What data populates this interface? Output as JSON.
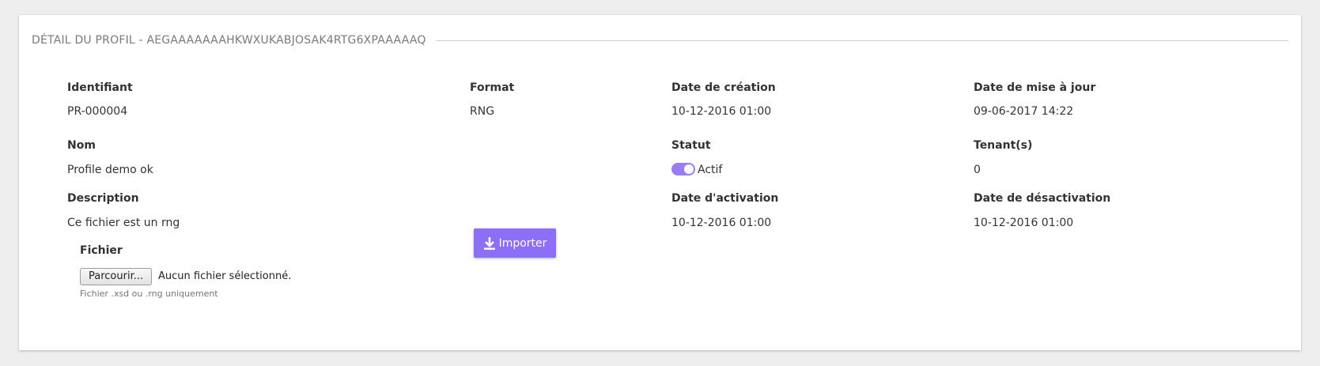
{
  "panel": {
    "title": "DÉTAIL DU PROFIL - AEGAAAAAAAHKWXUKABJOSAK4RTG6XPAAAAAQ"
  },
  "fields": {
    "identifiant": {
      "label": "Identifiant",
      "value": "PR-000004"
    },
    "format": {
      "label": "Format",
      "value": "RNG"
    },
    "date_creation": {
      "label": "Date de création",
      "value": "10-12-2016 01:00"
    },
    "date_maj": {
      "label": "Date de mise à jour",
      "value": "09-06-2017 14:22"
    },
    "nom": {
      "label": "Nom",
      "value": "Profile demo ok"
    },
    "statut": {
      "label": "Statut",
      "value": "Actif",
      "enabled": true
    },
    "tenants": {
      "label": "Tenant(s)",
      "value": "0"
    },
    "description": {
      "label": "Description",
      "value": "Ce fichier est un rng"
    },
    "date_activation": {
      "label": "Date d'activation",
      "value": "10-12-2016 01:00"
    },
    "date_desactivation": {
      "label": "Date de désactivation",
      "value": "10-12-2016 01:00"
    }
  },
  "file_upload": {
    "label": "Fichier",
    "browse_label": "Parcourir...",
    "no_file_text": "Aucun fichier sélectionné.",
    "hint": "Fichier .xsd ou .rng uniquement"
  },
  "import_button": {
    "label": "Importer",
    "icon": "download-icon"
  },
  "colors": {
    "accent": "#8c6ef7",
    "toggle": "#9a7df0",
    "background": "#eeeeee"
  }
}
